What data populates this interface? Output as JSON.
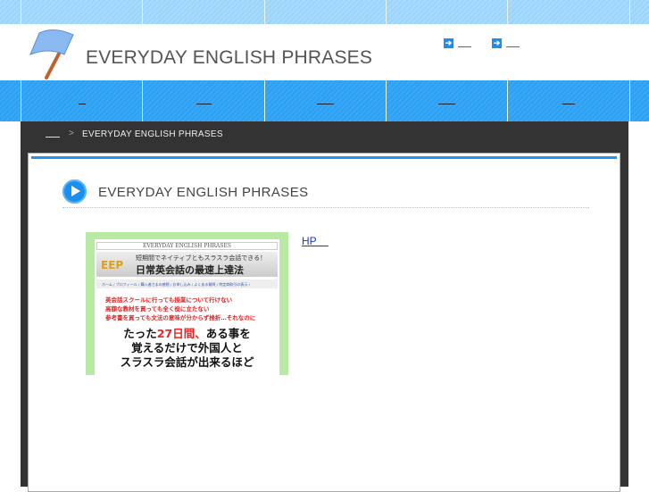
{
  "header": {
    "site_title": "EVERYDAY ENGLISH PHRASES",
    "top_links": [
      {
        "icon": "arrow-right-icon"
      },
      {
        "icon": "arrow-right-icon"
      }
    ]
  },
  "nav": {
    "item_count": 5
  },
  "breadcrumb": {
    "separator": ">",
    "current": "EVERYDAY ENGLISH PHRASES"
  },
  "main": {
    "heading": "EVERYDAY ENGLISH PHRASES",
    "heading_icon": "play-circle-icon",
    "link_label": "HP    ",
    "screenshot": {
      "top_caption": "EVERYDAY ENGLISH PHRASES",
      "logo": "EEP",
      "tagline": "短期間でネイティブともスラスラ会話できる！",
      "title": "日常英会話の最速上達法",
      "menu": "ホーム / プロフィール / 購入者さまの感想 / お申し込み / よくある質問 / 特定商取引の表示 /",
      "red_lines": [
        "英会話スクールに行っても授業について行けない",
        "高額な教材を買っても全く役に立たない",
        "参考書を買っても文法の意味が分からず挫折…それなのに"
      ],
      "big_pre": "たった",
      "big_red": "27日間、",
      "big_post": "ある事を",
      "big_line2": "覚えるだけで外国人と",
      "big_line3": "スラスラ会話が出来るほど"
    }
  },
  "colors": {
    "accent": "#1a8ff0",
    "stripe_light": "#a9dcfc",
    "stripe_dark": "#3aa9f5",
    "crumb_bg": "#333333"
  }
}
